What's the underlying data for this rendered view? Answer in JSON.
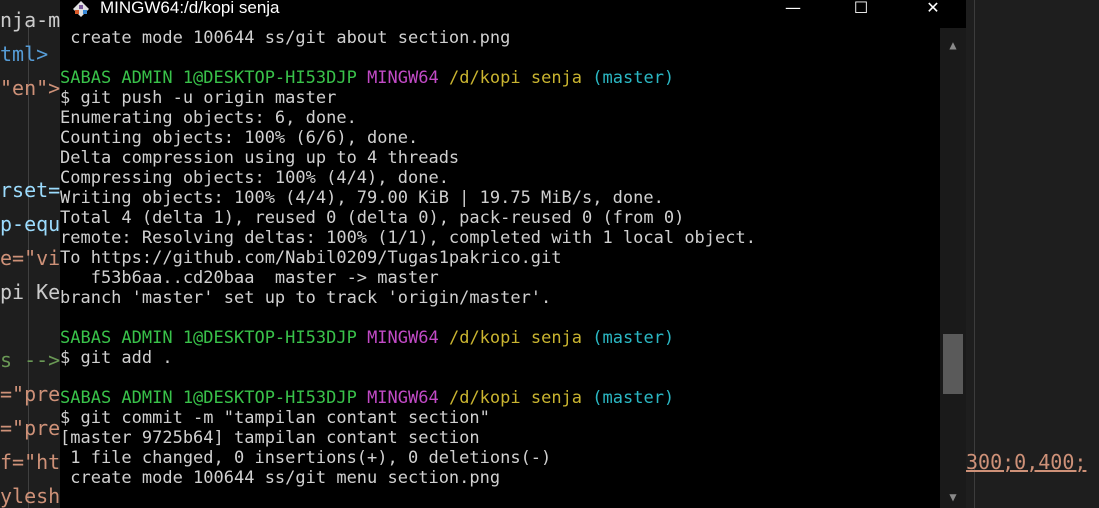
{
  "window": {
    "title": "MINGW64:/d/kopi senja",
    "minimize_glyph": "—",
    "maximize_glyph": "☐",
    "close_glyph": "✕"
  },
  "background_editor": {
    "left_lines": [
      {
        "text": "nja-m",
        "color": "#cccccc"
      },
      {
        "text": "tml>",
        "color": "#569cd6"
      },
      {
        "text": "\"en\">",
        "color": "#ce9178"
      },
      {
        "text": "",
        "color": "#cccccc"
      },
      {
        "text": "",
        "color": "#cccccc"
      },
      {
        "text": "rset=",
        "color": "#9cdcfe"
      },
      {
        "text": "p-equ",
        "color": "#9cdcfe"
      },
      {
        "text": "e=\"vi",
        "color": "#ce9178"
      },
      {
        "text": "pi Ke",
        "color": "#cccccc"
      },
      {
        "text": "",
        "color": "#cccccc"
      },
      {
        "text": "s -->",
        "color": "#6a9955"
      },
      {
        "text": "=\"pre",
        "color": "#ce9178"
      },
      {
        "text": "=\"pre",
        "color": "#ce9178"
      },
      {
        "text": "f=\"ht",
        "color": "#ce9178"
      },
      {
        "text": "ylesh",
        "color": "#ce9178"
      }
    ],
    "right_text": "300;0,400;"
  },
  "terminal_lines": [
    [
      {
        "t": " create mode 100644 ss/git about section.png",
        "c": ""
      }
    ],
    [
      {
        "t": "",
        "c": ""
      }
    ],
    [
      {
        "t": "SABAS ADMIN 1@DESKTOP-HI53DJP",
        "c": "green"
      },
      {
        "t": " ",
        "c": ""
      },
      {
        "t": "MINGW64",
        "c": "magenta"
      },
      {
        "t": " ",
        "c": ""
      },
      {
        "t": "/d/kopi senja",
        "c": "yellow"
      },
      {
        "t": " ",
        "c": ""
      },
      {
        "t": "(master)",
        "c": "cyan"
      }
    ],
    [
      {
        "t": "$ git push -u origin master",
        "c": ""
      }
    ],
    [
      {
        "t": "Enumerating objects: 6, done.",
        "c": ""
      }
    ],
    [
      {
        "t": "Counting objects: 100% (6/6), done.",
        "c": ""
      }
    ],
    [
      {
        "t": "Delta compression using up to 4 threads",
        "c": ""
      }
    ],
    [
      {
        "t": "Compressing objects: 100% (4/4), done.",
        "c": ""
      }
    ],
    [
      {
        "t": "Writing objects: 100% (4/4), 79.00 KiB | 19.75 MiB/s, done.",
        "c": ""
      }
    ],
    [
      {
        "t": "Total 4 (delta 1), reused 0 (delta 0), pack-reused 0 (from 0)",
        "c": ""
      }
    ],
    [
      {
        "t": "remote: Resolving deltas: 100% (1/1), completed with 1 local object.",
        "c": ""
      }
    ],
    [
      {
        "t": "To https://github.com/Nabil0209/Tugas1pakrico.git",
        "c": ""
      }
    ],
    [
      {
        "t": "   f53b6aa..cd20baa  master -> master",
        "c": ""
      }
    ],
    [
      {
        "t": "branch 'master' set up to track 'origin/master'.",
        "c": ""
      }
    ],
    [
      {
        "t": "",
        "c": ""
      }
    ],
    [
      {
        "t": "SABAS ADMIN 1@DESKTOP-HI53DJP",
        "c": "green"
      },
      {
        "t": " ",
        "c": ""
      },
      {
        "t": "MINGW64",
        "c": "magenta"
      },
      {
        "t": " ",
        "c": ""
      },
      {
        "t": "/d/kopi senja",
        "c": "yellow"
      },
      {
        "t": " ",
        "c": ""
      },
      {
        "t": "(master)",
        "c": "cyan"
      }
    ],
    [
      {
        "t": "$ git add .",
        "c": ""
      }
    ],
    [
      {
        "t": "",
        "c": ""
      }
    ],
    [
      {
        "t": "SABAS ADMIN 1@DESKTOP-HI53DJP",
        "c": "green"
      },
      {
        "t": " ",
        "c": ""
      },
      {
        "t": "MINGW64",
        "c": "magenta"
      },
      {
        "t": " ",
        "c": ""
      },
      {
        "t": "/d/kopi senja",
        "c": "yellow"
      },
      {
        "t": " ",
        "c": ""
      },
      {
        "t": "(master)",
        "c": "cyan"
      }
    ],
    [
      {
        "t": "$ git commit -m \"tampilan contant section\"",
        "c": ""
      }
    ],
    [
      {
        "t": "[master 9725b64] tampilan contant section",
        "c": ""
      }
    ],
    [
      {
        "t": " 1 file changed, 0 insertions(+), 0 deletions(-)",
        "c": ""
      }
    ],
    [
      {
        "t": " create mode 100644 ss/git menu section.png",
        "c": ""
      }
    ]
  ],
  "scrollbar": {
    "up_glyph": "▲",
    "down_glyph": "▼",
    "thumb_position": 0.75,
    "thumb_fraction": 0.14
  },
  "colors": {
    "prompt_user": "#39c24a",
    "prompt_env": "#c24ac6",
    "prompt_path": "#c9b430",
    "prompt_branch": "#2bb8c4"
  }
}
